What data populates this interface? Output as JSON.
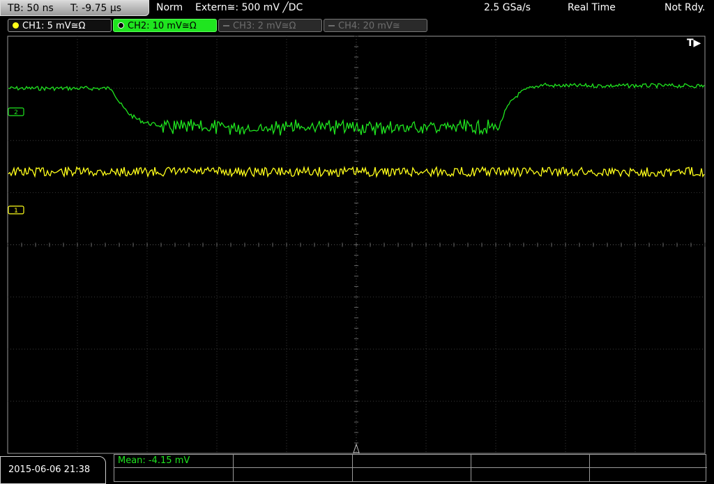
{
  "topbar": {
    "timebase": "TB: 50 ns",
    "trigger_time": "T: -9.75 µs",
    "trigger_mode": "Norm",
    "trigger_source": "Extern≅: 500 mV ╱DC",
    "sample_rate": "2.5 GSa/s",
    "acquisition_mode": "Real Time",
    "status": "Not Rdy."
  },
  "channels": [
    {
      "label": "CH1: 5 mV≅Ω",
      "color": "#ffff1a",
      "active": true
    },
    {
      "label": "CH2: 10 mV≅Ω",
      "color": "#1fe51f",
      "active": true,
      "selected": true
    },
    {
      "label": "CH3: 2 mV≅Ω",
      "color": "#6e6e6e",
      "active": false
    },
    {
      "label": "CH4: 20 mV≅",
      "color": "#6e6e6e",
      "active": false
    }
  ],
  "screen": {
    "trigger_marker": "T▶",
    "ch2_marker": "2",
    "ch1_marker": "1"
  },
  "traces": {
    "ch2": {
      "high_level_div": 1.0,
      "low_level_div": 0.25,
      "fall_start_div": 1.5,
      "fall_end_div": 2.2,
      "rise_start_div": 7.05,
      "rise_end_div": 7.75
    },
    "ch1": {
      "level_div": 0.7
    }
  },
  "footer": {
    "datetime": "2015-06-06 21:38",
    "measurement": "Mean: -4.15 mV"
  }
}
